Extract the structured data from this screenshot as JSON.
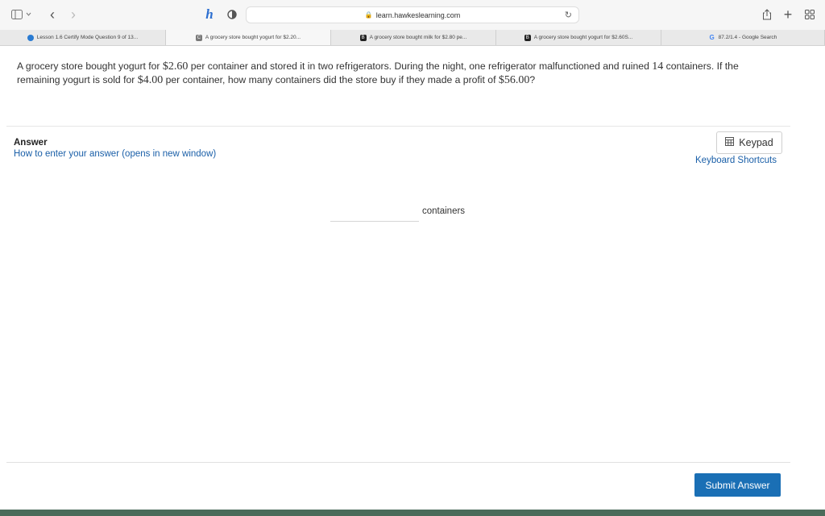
{
  "browser": {
    "address": "learn.hawkeslearning.com",
    "tabs": [
      {
        "label": "Lesson 1.6 Certify Mode Question 9 of 13...",
        "favicon": "globe-icon"
      },
      {
        "label": "A grocery store bought yogurt for $2.20...",
        "favicon": "c-icon"
      },
      {
        "label": "A grocery store bought milk for $2.80 pe...",
        "favicon": "b-icon"
      },
      {
        "label": "A grocery store bought yogurt for $2.60S...",
        "favicon": "b-icon"
      },
      {
        "label": "87.2/1.4 - Google Search",
        "favicon": "google-icon"
      }
    ]
  },
  "question": {
    "t1": "A grocery store bought yogurt for ",
    "m1": "$2.60",
    "t2": " per container and stored it in two refrigerators.  During the night, one refrigerator malfunctioned and ruined ",
    "m2": "14",
    "t3": " containers.  If the remaining yogurt is sold for ",
    "m3": "$4.00",
    "t4": " per container, how many containers did the store buy if they made a profit of ",
    "m4": "$56.00",
    "t5": "?"
  },
  "answer": {
    "label": "Answer",
    "how_link": "How to enter your answer (opens in new window)",
    "keypad_label": "Keypad",
    "shortcuts_label": "Keyboard Shortcuts",
    "input_value": "",
    "unit": "containers",
    "submit_label": "Submit Answer"
  },
  "colors": {
    "link": "#1a5fa8",
    "submit": "#1a6fb5",
    "bottom_bar": "#4b6b5a"
  }
}
